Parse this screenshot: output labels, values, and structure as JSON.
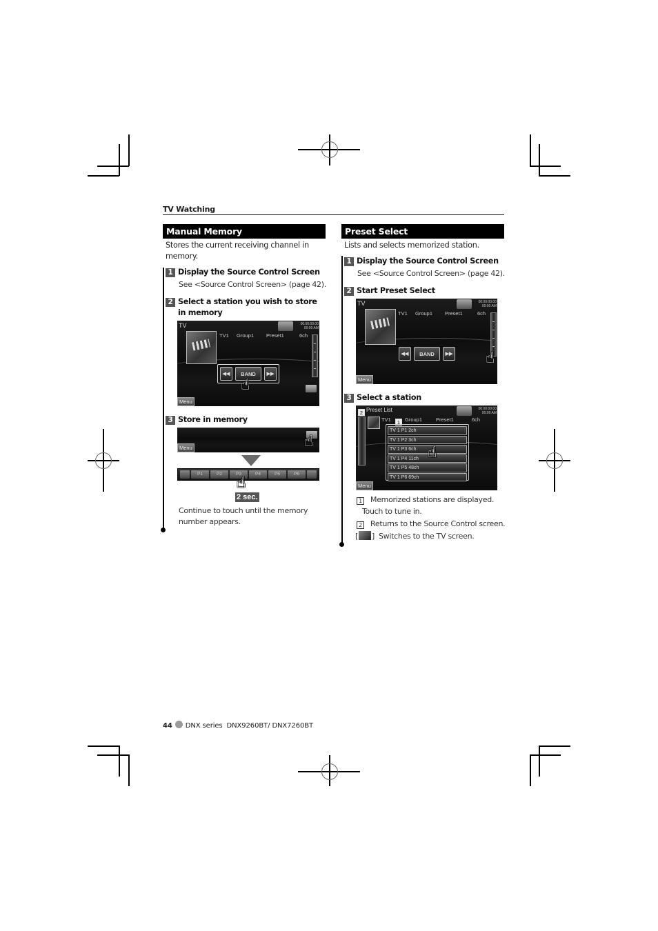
{
  "running_head": "TV Watching",
  "left_section": {
    "title": "Manual Memory",
    "intro": "Stores the current receiving channel in memory.",
    "steps": [
      {
        "num": "1",
        "title": "Display the Source Control Screen",
        "text": "See <Source Control Screen> (page 42)."
      },
      {
        "num": "2",
        "title": "Select a station you wish to store in memory"
      },
      {
        "num": "3",
        "title": "Store in memory",
        "text": "Continue to touch until the memory number appears."
      }
    ],
    "screen1": {
      "source": "TV",
      "clock": [
        "00:00:00:00",
        "00:00 AM"
      ],
      "info": [
        "TV1",
        "Group1",
        "Preset1",
        "6ch"
      ],
      "controls": [
        "◀◀",
        "BAND",
        "▶▶"
      ],
      "menu": "Menu"
    },
    "screen2": {
      "menu": "Menu"
    },
    "preset_bar": [
      "P1",
      "P2",
      "P3",
      "P4",
      "P5",
      "P6"
    ],
    "hold_badge": "2 sec."
  },
  "right_section": {
    "title": "Preset Select",
    "intro": "Lists and selects memorized station.",
    "steps": [
      {
        "num": "1",
        "title": "Display the Source Control Screen",
        "text": "See <Source Control Screen> (page 42)."
      },
      {
        "num": "2",
        "title": "Start Preset Select"
      },
      {
        "num": "3",
        "title": "Select a station"
      }
    ],
    "screen1": {
      "source": "TV",
      "clock": [
        "00:00:00:00",
        "00:00 AM"
      ],
      "info": [
        "TV1",
        "Group1",
        "Preset1",
        "6ch"
      ],
      "controls": [
        "◀◀",
        "BAND",
        "▶▶"
      ],
      "menu": "Menu"
    },
    "preset_list_screen": {
      "title": "Preset List",
      "clock": [
        "00:00:00:00",
        "00:00 AM"
      ],
      "info": [
        "TV1",
        "Group1",
        "Preset1",
        "6ch"
      ],
      "rows": [
        "TV 1  P1  2ch",
        "TV 1  P2  3ch",
        "TV 1  P3  6ch",
        "TV 1  P4  11ch",
        "TV 1  P5  48ch",
        "TV 1  P6  69ch"
      ],
      "callouts": [
        "1",
        "2"
      ],
      "menu": "Menu"
    },
    "legend": [
      {
        "key": "1",
        "text": "Memorized stations are displayed.",
        "text2": "Touch to tune in."
      },
      {
        "key": "2",
        "text": "Returns to the Source Control screen."
      },
      {
        "key": "tv-icon",
        "text": "Switches to the TV screen."
      }
    ]
  },
  "footer": {
    "page": "44",
    "series": "DNX series",
    "models": "DNX9260BT/ DNX7260BT"
  }
}
